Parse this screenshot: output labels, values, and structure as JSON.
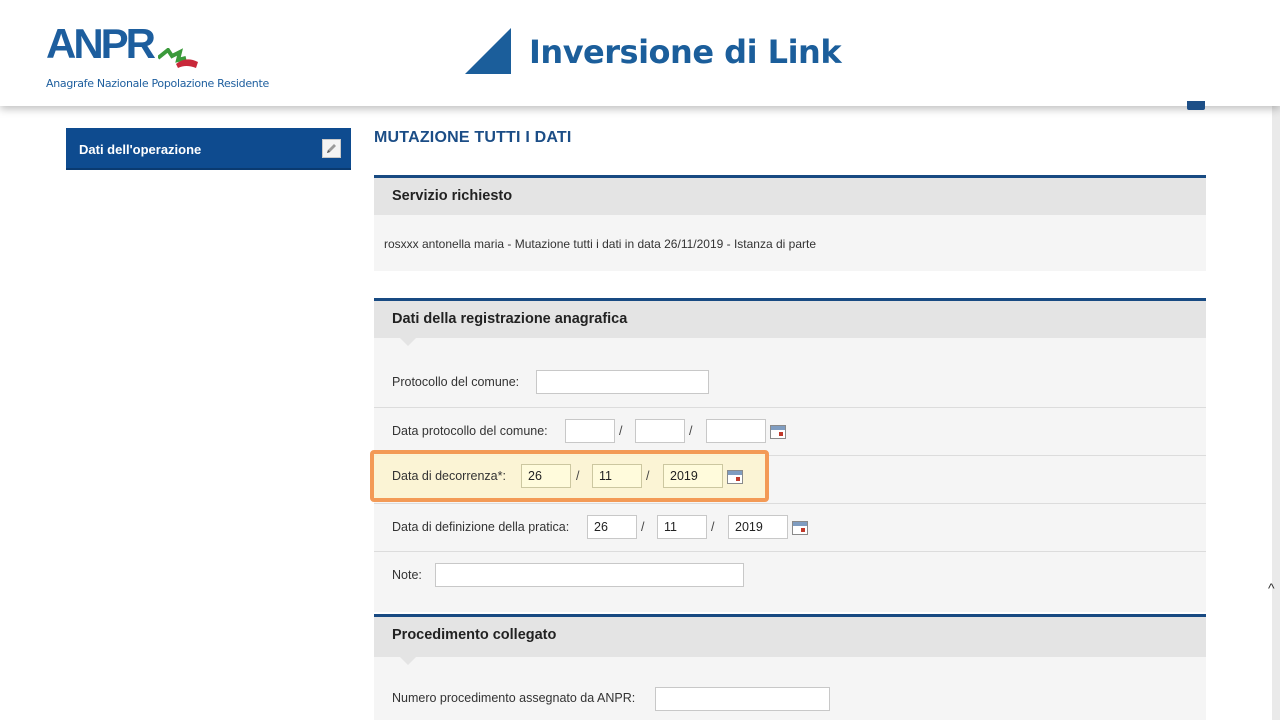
{
  "header": {
    "logo_text": "ANPR",
    "logo_subtitle": "Anagrafe Nazionale Popolazione Residente",
    "title": "Inversione di Link"
  },
  "sidebar": {
    "items": [
      {
        "label": "Dati dell'operazione",
        "icon": "pencil-icon"
      }
    ]
  },
  "main": {
    "heading": "MUTAZIONE TUTTI I DATI",
    "servizio": {
      "title": "Servizio richiesto",
      "description": "rosxxx antonella maria - Mutazione tutti i dati in data 26/11/2019 - Istanza di parte"
    },
    "registrazione": {
      "title": "Dati della registrazione anagrafica",
      "protocollo_label": "Protocollo del comune:",
      "protocollo_value": "",
      "data_protocollo_label": "Data protocollo del comune:",
      "data_protocollo": {
        "day": "",
        "month": "",
        "year": ""
      },
      "decorrenza_label": "Data di decorrenza*:",
      "decorrenza": {
        "day": "26",
        "month": "11",
        "year": "2019"
      },
      "definizione_label": "Data di definizione della pratica:",
      "definizione": {
        "day": "26",
        "month": "11",
        "year": "2019"
      },
      "note_label": "Note:",
      "note_value": "",
      "date_separator": "/"
    },
    "procedimento": {
      "title": "Procedimento collegato",
      "numero_label": "Numero procedimento assegnato da ANPR:",
      "numero_value": ""
    }
  },
  "colors": {
    "brand_blue": "#0e4b8f",
    "highlight_orange": "#f39a56",
    "required_field_yellow": "#fffbdc"
  }
}
